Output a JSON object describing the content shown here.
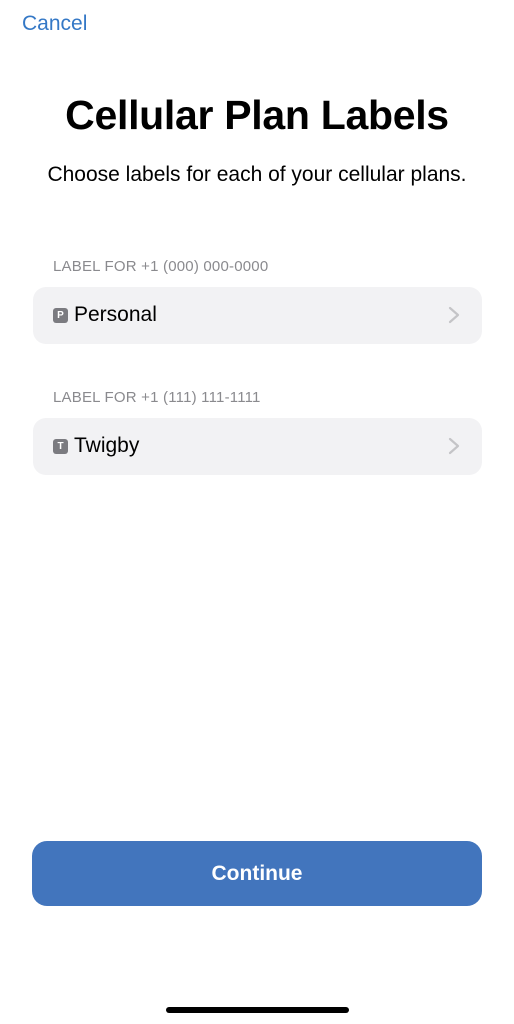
{
  "nav": {
    "cancel_label": "Cancel"
  },
  "header": {
    "title": "Cellular Plan Labels",
    "subtitle": "Choose labels for each of your cellular plans."
  },
  "plans": [
    {
      "section_label": "LABEL FOR +1 (000) 000-0000",
      "badge": "P",
      "label": "Personal"
    },
    {
      "section_label": "LABEL FOR +1 (111) 111-1111",
      "badge": "T",
      "label": "Twigby"
    }
  ],
  "footer": {
    "continue_label": "Continue"
  },
  "colors": {
    "accent": "#3478c6",
    "button": "#4275bd",
    "row_bg": "#f2f2f4",
    "secondary_text": "#8a8a8e"
  },
  "icons": {
    "row_chevron": "chevron-right-icon"
  }
}
